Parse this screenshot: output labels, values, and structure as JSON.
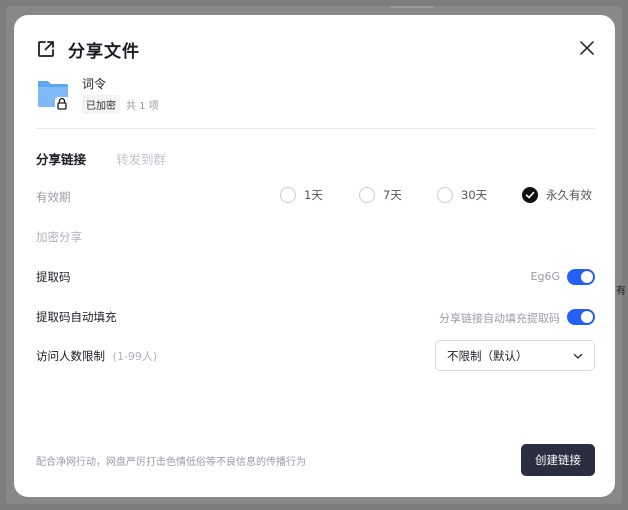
{
  "dialog": {
    "title": "分享文件",
    "file": {
      "name": "词令",
      "badge": "已加密",
      "count": "共 1 项"
    },
    "tabs": [
      {
        "label": "分享链接",
        "active": true
      },
      {
        "label": "转发到群",
        "active": false
      }
    ],
    "validity": {
      "label": "有效期",
      "options": [
        "1天",
        "7天",
        "30天",
        "永久有效"
      ],
      "selected": "永久有效"
    },
    "encrypt_label": "加密分享",
    "extract_code": {
      "label": "提取码",
      "value": "Eg6G",
      "enabled": true
    },
    "auto_fill": {
      "label": "提取码自动填充",
      "desc": "分享链接自动填充提取码",
      "enabled": true
    },
    "visitor_limit": {
      "label": "访问人数限制",
      "range": "(1-99人)",
      "selected": "不限制（默认）"
    },
    "footer_note": "配合净网行动，网盘严厉打击色情低俗等不良信息的传播行为",
    "create_button": "创建链接"
  },
  "colors": {
    "accent": "#2460f5",
    "primary_button": "#2b2e3f",
    "folder": "#6aaef5"
  },
  "background": {
    "edge_text": "有"
  }
}
